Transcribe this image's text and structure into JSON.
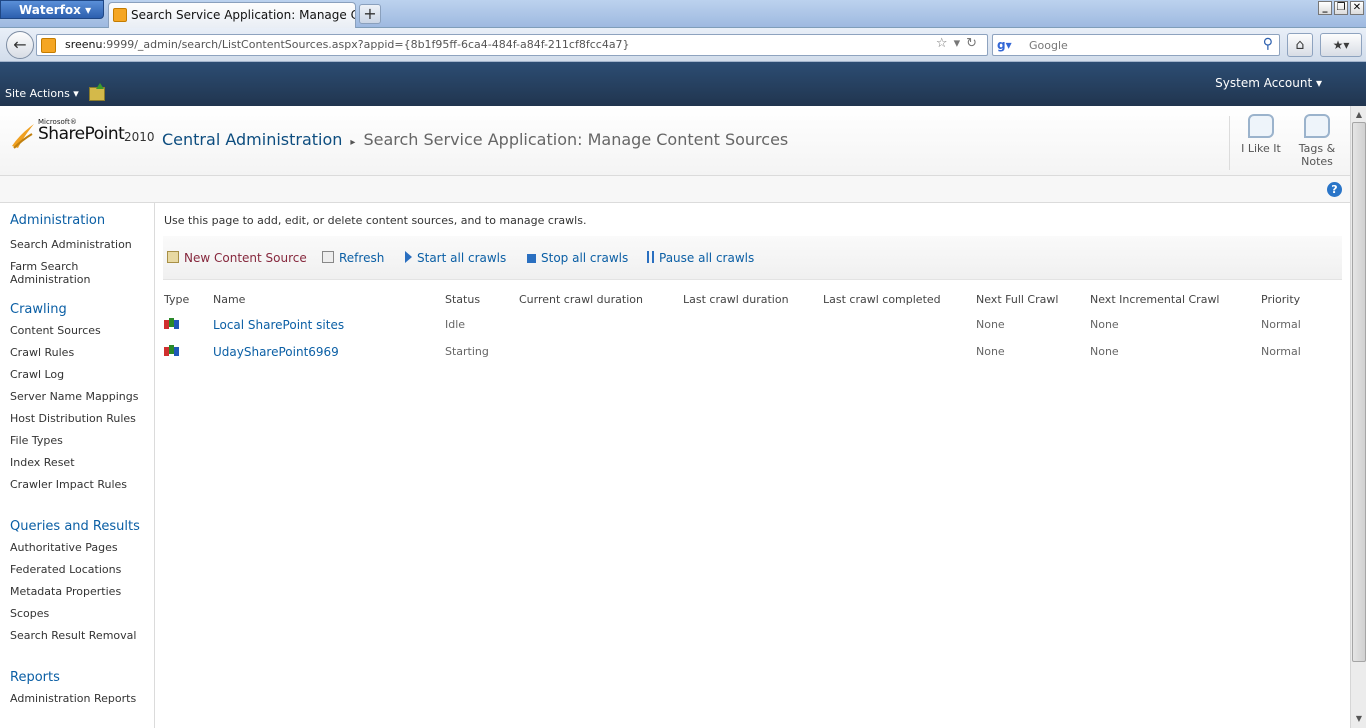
{
  "browser": {
    "app_button": "Waterfox",
    "tab_title": "Search Service Application: Manage Content...",
    "new_tab": "+",
    "url_host": "sreenu",
    "url_rest": ":9999/_admin/search/ListContentSources.aspx?appid={8b1f95ff-6ca4-484f-a84f-211cf8fcc4a7}",
    "search_placeholder": "Google"
  },
  "ribbon": {
    "site_actions": "Site Actions",
    "account": "System Account"
  },
  "title": {
    "logo_ms": "Microsoft®",
    "logo_sp": "SharePoint",
    "logo_year": "2010",
    "breadcrumb_root": "Central Administration",
    "breadcrumb_page": "Search Service Application: Manage Content Sources",
    "i_like_it": "I Like It",
    "tags_notes_1": "Tags &",
    "tags_notes_2": "Notes",
    "help": "?"
  },
  "leftnav": {
    "administration": "Administration",
    "admin_items": [
      "Search Administration",
      "Farm Search Administration"
    ],
    "crawling": "Crawling",
    "crawling_items": [
      "Content Sources",
      "Crawl Rules",
      "Crawl Log",
      "Server Name Mappings",
      "Host Distribution Rules",
      "File Types",
      "Index Reset",
      "Crawler Impact Rules"
    ],
    "queries": "Queries and Results",
    "queries_items": [
      "Authoritative Pages",
      "Federated Locations",
      "Metadata Properties",
      "Scopes",
      "Search Result Removal"
    ],
    "reports": "Reports",
    "reports_items": [
      "Administration Reports"
    ]
  },
  "main": {
    "description": "Use this page to add, edit, or delete content sources, and to manage crawls.",
    "toolbar": {
      "new": "New Content Source",
      "refresh": "Refresh",
      "start": "Start all crawls",
      "stop": "Stop all crawls",
      "pause": "Pause all crawls"
    },
    "columns": [
      "Type",
      "Name",
      "Status",
      "Current crawl duration",
      "Last crawl duration",
      "Last crawl completed",
      "Next Full Crawl",
      "Next Incremental Crawl",
      "Priority"
    ],
    "rows": [
      {
        "name": "Local SharePoint sites",
        "status": "Idle",
        "current": "",
        "last": "",
        "completed": "",
        "next_full": "None",
        "next_incr": "None",
        "priority": "Normal"
      },
      {
        "name": "UdaySharePoint6969",
        "status": "Starting",
        "current": "",
        "last": "",
        "completed": "",
        "next_full": "None",
        "next_incr": "None",
        "priority": "Normal"
      }
    ]
  }
}
